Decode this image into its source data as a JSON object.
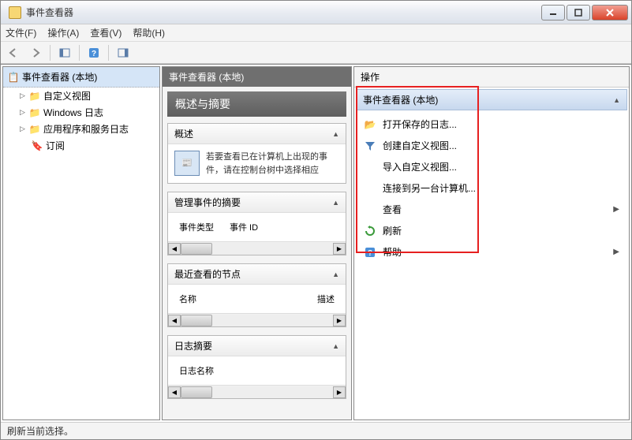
{
  "window": {
    "title": "事件查看器"
  },
  "menubar": {
    "file": "文件(F)",
    "action": "操作(A)",
    "view": "查看(V)",
    "help": "帮助(H)"
  },
  "tree": {
    "root": "事件查看器 (本地)",
    "items": [
      {
        "label": "自定义视图",
        "expandable": true
      },
      {
        "label": "Windows 日志",
        "expandable": true
      },
      {
        "label": "应用程序和服务日志",
        "expandable": true
      },
      {
        "label": "订阅",
        "expandable": false
      }
    ]
  },
  "center": {
    "header": "事件查看器 (本地)",
    "title": "概述与摘要",
    "sections": {
      "overview": {
        "title": "概述",
        "desc": "若要查看已在计算机上出现的事件，请在控制台树中选择相应"
      },
      "admin": {
        "title": "管理事件的摘要",
        "cols": [
          "事件类型",
          "事件 ID"
        ]
      },
      "recent": {
        "title": "最近查看的节点",
        "cols": [
          "名称",
          "描述"
        ]
      },
      "log": {
        "title": "日志摘要",
        "cols": [
          "日志名称"
        ]
      }
    }
  },
  "actions": {
    "header": "操作",
    "group": "事件查看器 (本地)",
    "items": [
      {
        "label": "打开保存的日志...",
        "icon": "folder",
        "chevron": false
      },
      {
        "label": "创建自定义视图...",
        "icon": "filter",
        "chevron": false
      },
      {
        "label": "导入自定义视图...",
        "icon": "",
        "chevron": false
      },
      {
        "label": "连接到另一台计算机...",
        "icon": "",
        "chevron": false
      },
      {
        "label": "查看",
        "icon": "",
        "chevron": true
      },
      {
        "label": "刷新",
        "icon": "refresh",
        "chevron": false
      },
      {
        "label": "帮助",
        "icon": "help",
        "chevron": true
      }
    ]
  },
  "status": "刷新当前选择。"
}
